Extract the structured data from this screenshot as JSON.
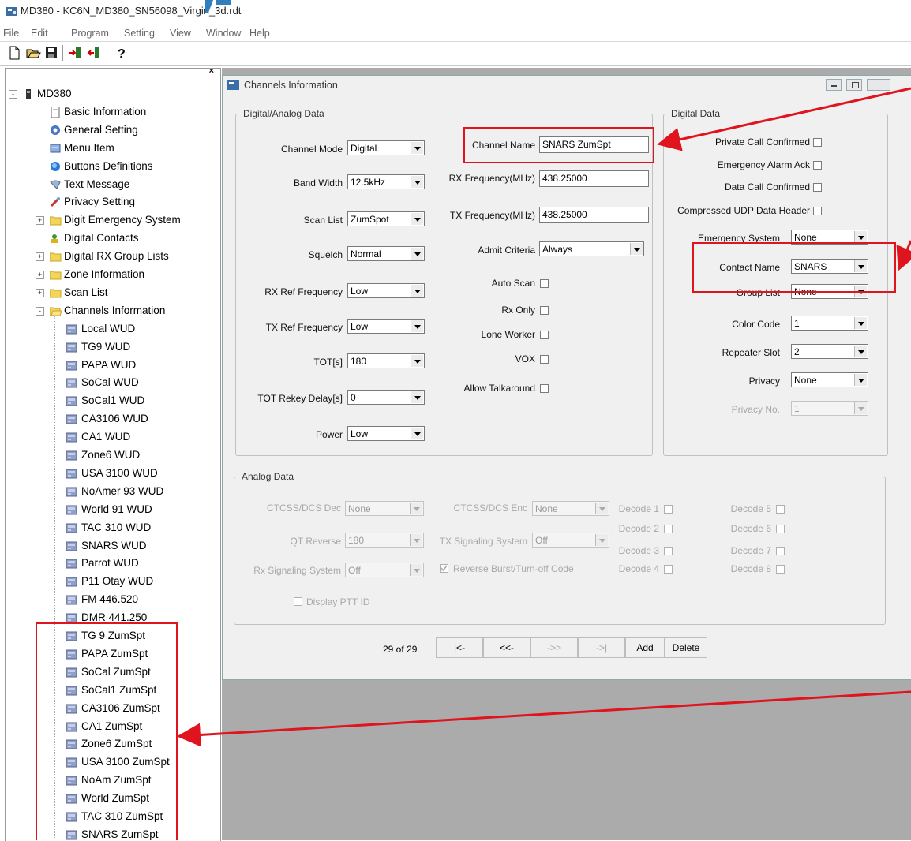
{
  "window": {
    "title": "MD380 - KC6N_MD380_SN56098_Virgin_3d.rdt"
  },
  "menu": [
    "File",
    "Edit",
    "Program",
    "Setting",
    "View",
    "Window",
    "Help"
  ],
  "toolbar": {
    "buttons": [
      "new-icon",
      "open-icon",
      "save-icon",
      "read-radio-icon",
      "write-radio-icon",
      "help-icon"
    ]
  },
  "tree": {
    "close_glyph": "×",
    "root": "MD380",
    "items": [
      {
        "label": "Basic Information",
        "icon": "document-icon",
        "expander": ""
      },
      {
        "label": "General Setting",
        "icon": "settings-icon",
        "expander": ""
      },
      {
        "label": "Menu Item",
        "icon": "menu-icon",
        "expander": ""
      },
      {
        "label": "Buttons Definitions",
        "icon": "button-icon",
        "expander": ""
      },
      {
        "label": "Text Message",
        "icon": "message-icon",
        "expander": ""
      },
      {
        "label": "Privacy Setting",
        "icon": "privacy-icon",
        "expander": ""
      },
      {
        "label": "Digit Emergency System",
        "icon": "folder-icon",
        "expander": "+"
      },
      {
        "label": "Digital Contacts",
        "icon": "contacts-icon",
        "expander": ""
      },
      {
        "label": "Digital RX Group Lists",
        "icon": "folder-icon",
        "expander": "+"
      },
      {
        "label": "Zone Information",
        "icon": "folder-icon",
        "expander": "+"
      },
      {
        "label": "Scan List",
        "icon": "folder-icon",
        "expander": "+"
      },
      {
        "label": "Channels Information",
        "icon": "folder-open-icon",
        "expander": "-"
      }
    ],
    "channels": [
      "Local WUD",
      "TG9 WUD",
      "PAPA WUD",
      "SoCal WUD",
      "SoCal1 WUD",
      "CA3106 WUD",
      "CA1 WUD",
      "Zone6 WUD",
      "USA 3100 WUD",
      "NoAmer 93 WUD",
      "World 91 WUD",
      "TAC 310 WUD",
      "SNARS WUD",
      "Parrot WUD",
      "P11 Otay WUD",
      "FM 446.520",
      "DMR 441.250",
      "TG 9 ZumSpt",
      "PAPA ZumSpt",
      "SoCal ZumSpt",
      "SoCal1 ZumSpt",
      "CA3106 ZumSpt",
      "CA1 ZumSpt",
      "Zone6 ZumSpt",
      "USA 3100 ZumSpt",
      "NoAm ZumSpt",
      "World ZumSpt",
      "TAC 310 ZumSpt",
      "SNARS ZumSpt"
    ]
  },
  "panel": {
    "title": "Channels Information",
    "da_group": "Digital/Analog Data",
    "dd_group": "Digital Data",
    "an_group": "Analog Data",
    "left_fields": [
      {
        "label": "Channel Mode",
        "value": "Digital"
      },
      {
        "label": "Band Width",
        "value": "12.5kHz"
      },
      {
        "label": "Scan List",
        "value": "ZumSpot"
      },
      {
        "label": "Squelch",
        "value": "Normal"
      },
      {
        "label": "RX Ref Frequency",
        "value": "Low"
      },
      {
        "label": "TX Ref Frequency",
        "value": "Low"
      },
      {
        "label": "TOT[s]",
        "value": "180"
      },
      {
        "label": "TOT Rekey Delay[s]",
        "value": "0"
      },
      {
        "label": "Power",
        "value": "Low"
      }
    ],
    "channel_name": {
      "label": "Channel Name",
      "value": "SNARS ZumSpt"
    },
    "rx_freq": {
      "label": "RX Frequency(MHz)",
      "value": "438.25000"
    },
    "tx_freq": {
      "label": "TX Frequency(MHz)",
      "value": "438.25000"
    },
    "admit": {
      "label": "Admit Criteria",
      "value": "Always"
    },
    "mid_checks": [
      "Auto Scan",
      "Rx Only",
      "Lone Worker",
      "VOX",
      "Allow Talkaround"
    ],
    "dd_checks": [
      "Private Call Confirmed",
      "Emergency Alarm Ack",
      "Data Call Confirmed",
      "Compressed UDP Data Header"
    ],
    "dd_fields": [
      {
        "label": "Emergency System",
        "value": "None"
      },
      {
        "label": "Contact Name",
        "value": "SNARS"
      },
      {
        "label": "Group List",
        "value": "None"
      },
      {
        "label": "Color Code",
        "value": "1"
      },
      {
        "label": "Repeater Slot",
        "value": "2"
      },
      {
        "label": "Privacy",
        "value": "None"
      },
      {
        "label": "Privacy No.",
        "value": "1"
      }
    ],
    "analog": {
      "ctcss_dec": {
        "label": "CTCSS/DCS Dec",
        "value": "None"
      },
      "ctcss_enc": {
        "label": "CTCSS/DCS Enc",
        "value": "None"
      },
      "qt_reverse": {
        "label": "QT Reverse",
        "value": "180"
      },
      "tx_sig": {
        "label": "TX Signaling System",
        "value": "Off"
      },
      "rx_sig": {
        "label": "Rx Signaling System",
        "value": "Off"
      },
      "reverse_burst": "Reverse Burst/Turn-off Code",
      "display_ptt": "Display PTT ID",
      "decodes": [
        "Decode 1",
        "Decode 2",
        "Decode 3",
        "Decode 4",
        "Decode 5",
        "Decode 6",
        "Decode 7",
        "Decode 8"
      ]
    },
    "nav": {
      "count": "29 of 29",
      "first": "|<-",
      "prev": "<<-",
      "next": "->>",
      "last": "->|",
      "add": "Add",
      "delete": "Delete"
    }
  },
  "colors": {
    "annotation": "#e0141e"
  }
}
